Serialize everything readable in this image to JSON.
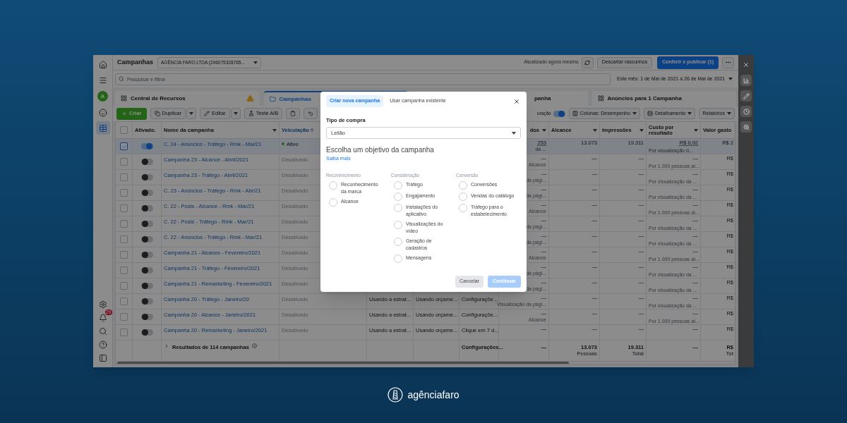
{
  "sidebar": {
    "avatar": "A",
    "items": [
      {
        "kind": "home",
        "selected": false
      },
      {
        "kind": "menu",
        "selected": false
      },
      {
        "kind": "emoji",
        "selected": false
      },
      {
        "kind": "table",
        "selected": true
      },
      {
        "kind": "settings",
        "selected": false
      },
      {
        "kind": "bell",
        "badge": "29",
        "selected": false
      },
      {
        "kind": "search",
        "selected": false
      },
      {
        "kind": "help",
        "selected": false
      },
      {
        "kind": "panel",
        "selected": false
      }
    ]
  },
  "header": {
    "title": "Campanhas",
    "account": "AGÊNCIA FARO LTDA (246075328765...",
    "status": "Atualizado agora mesmo",
    "discard": "Descartar rascunhos",
    "publish": "Conferir e publicar (1)"
  },
  "search": {
    "placeholder": "Pesquisar e filtrar",
    "date_range": "Este mês: 1 de Mai de 2021 a 26 de Mai de 2021"
  },
  "tabs": [
    {
      "label": "Central de Recursos",
      "selected": false,
      "warning": true
    },
    {
      "label": "Campanhas",
      "selected": true,
      "warning": false
    },
    {
      "label": "panha",
      "selected": false,
      "warning": false
    },
    {
      "label": "Anúncios para 1 Campanha",
      "selected": false,
      "warning": false
    }
  ],
  "toolbar": {
    "create": "Criar",
    "duplicate": "Duplicar",
    "edit": "Editar",
    "ab_test": "Teste A/B",
    "view_label": "uração",
    "view_on": true,
    "columns": "Colunas: Desempenho",
    "breakdown": "Detalhamento",
    "reports": "Relatórios"
  },
  "table": {
    "select_all_checked": false,
    "header": {
      "active": "Ativado.",
      "name": "Nome da campanha",
      "delivery": "Veiculação",
      "results": "dos",
      "reach": "Alcance",
      "impressions": "Impressões",
      "cost": "Custo por resultado",
      "spent": "Valor gasto"
    },
    "rows": [
      {
        "selected": true,
        "checked": true,
        "on": true,
        "name": "C. 24 - Anúncios - Tráfego - Rmk - Mai/21",
        "delivery": "Ativo",
        "delivery_active": true,
        "results": "253",
        "results_note": "da ...",
        "reach": "13.073",
        "impressions": "19.311",
        "cost": "R$ 0,92",
        "cost_note": "Por visualização d...",
        "spent": "R$ 2"
      },
      {
        "selected": false,
        "checked": false,
        "on": false,
        "name": "Campanha 23 - Alcance - Abril/2021",
        "delivery": "Desativado",
        "delivery_active": false,
        "results": "—",
        "results_note": "Alcance",
        "reach": "—",
        "impressions": "—",
        "cost": "—",
        "cost_note": "Por 1.000 pessoas al...",
        "spent": "R$"
      },
      {
        "selected": false,
        "checked": false,
        "on": false,
        "name": "Campanha 23 - Tráfego - Abril/2021",
        "delivery": "Desativado",
        "delivery_active": false,
        "results": "—",
        "results_note": "da pági...",
        "reach": "—",
        "impressions": "—",
        "cost": "—",
        "cost_note": "Por visualização da ...",
        "spent": "R$"
      },
      {
        "selected": false,
        "checked": false,
        "on": false,
        "name": "C. 23 - Anúncios - Tráfego - Rmk - Abr/21",
        "delivery": "Desativado",
        "delivery_active": false,
        "results": "—",
        "results_note": "da pági...",
        "reach": "—",
        "impressions": "—",
        "cost": "—",
        "cost_note": "Por visualização da ...",
        "spent": "R$"
      },
      {
        "selected": false,
        "checked": false,
        "on": false,
        "name": "C. 22 - Posts - Alcance - Rmk - Mar/21",
        "delivery": "Desativado",
        "delivery_active": false,
        "results": "—",
        "results_note": "Alcance",
        "reach": "—",
        "impressions": "—",
        "cost": "—",
        "cost_note": "Por 1.000 pessoas al...",
        "spent": "R$"
      },
      {
        "selected": false,
        "checked": false,
        "on": false,
        "name": "C. 22 - Posts - Tráfego - Rmk - Mar/21",
        "delivery": "Desativado",
        "delivery_active": false,
        "results": "—",
        "results_note": "da pági...",
        "reach": "—",
        "impressions": "—",
        "cost": "—",
        "cost_note": "Por visualização da ...",
        "spent": "R$"
      },
      {
        "selected": false,
        "checked": false,
        "on": false,
        "name": "C. 22 - Anúncios - Tráfego - Rmk - Mar/21",
        "delivery": "Desativado",
        "delivery_active": false,
        "results": "—",
        "results_note": "da pági...",
        "reach": "—",
        "impressions": "—",
        "cost": "—",
        "cost_note": "Por visualização da ...",
        "spent": "R$"
      },
      {
        "selected": false,
        "checked": false,
        "on": false,
        "name": "Campanha 21 - Alcance - Fevereiro/2021",
        "delivery": "Desativado",
        "delivery_active": false,
        "results": "—",
        "results_note": "Alcance",
        "reach": "—",
        "impressions": "—",
        "cost": "—",
        "cost_note": "Por 1.000 pessoas al...",
        "spent": "R$"
      },
      {
        "selected": false,
        "checked": false,
        "on": false,
        "name": "Campanha 21 - Tráfego - Fevereiro/2021",
        "delivery": "Desativado",
        "delivery_active": false,
        "results": "—",
        "results_note": "da pági...",
        "reach": "—",
        "impressions": "—",
        "cost": "—",
        "cost_note": "Por visualização da ...",
        "spent": "R$"
      },
      {
        "selected": false,
        "checked": false,
        "on": false,
        "name": "Campanha 21 - Remarketing - Fevereiro/2021",
        "delivery": "Desativado",
        "delivery_active": false,
        "results": "—",
        "results_note": "da pági...",
        "reach": "—",
        "impressions": "—",
        "cost": "—",
        "cost_note": "Por visualização da ...",
        "spent": "R$"
      },
      {
        "selected": false,
        "checked": false,
        "on": false,
        "name": "Campanha 20 - Tráfego - Janeiro/20",
        "delivery": "Desativado",
        "delivery_active": false,
        "bid_strategy": "Usando a estrat...",
        "budget": "Usando orçame...",
        "attribution": "Configuraçõe...",
        "results": "—",
        "results_note": "Visualização da pági...",
        "reach": "—",
        "impressions": "—",
        "cost": "—",
        "cost_note": "Por visualização da ...",
        "spent": "R$"
      },
      {
        "selected": false,
        "checked": false,
        "on": false,
        "name": "Campanha 20 - Alcance - Janeiro/2021",
        "delivery": "Desativado",
        "delivery_active": false,
        "bid_strategy": "Usando a estrat...",
        "budget": "Usando orçame...",
        "attribution": "Configuraçõe...",
        "results": "—",
        "results_note": "Alcance",
        "reach": "—",
        "impressions": "—",
        "cost": "—",
        "cost_note": "Por 1.000 pessoas al...",
        "spent": "R$"
      },
      {
        "selected": false,
        "checked": false,
        "on": false,
        "name": "Campanha 20 - Remarketing - Janeiro/2021",
        "delivery": "Desativado",
        "delivery_active": false,
        "bid_strategy": "Usando a estrat...",
        "budget": "Usando orçame...",
        "attribution": "Clique em 7 d...",
        "results": "—",
        "reach": "—",
        "impressions": "—",
        "cost": "—",
        "spent": "R$"
      }
    ],
    "footer": {
      "label": "Resultados de 114 campanhas",
      "attribution": "Configurações...",
      "results": "—",
      "reach": "13.073",
      "reach_note": "Pessoas",
      "impressions": "19.311",
      "impressions_note": "Total",
      "cost": "—",
      "spent": "R$",
      "spent_note": "Tot"
    }
  },
  "modal": {
    "tabs": [
      {
        "label": "Criar nova campanha",
        "selected": true
      },
      {
        "label": "Usar campanha existente",
        "selected": false
      }
    ],
    "buying_label": "Tipo de compra",
    "buying_type": "Leilão",
    "heading": "Escolha um objetivo da campanha",
    "link": "Saiba mais",
    "groups": [
      {
        "title": "Reconhecimento",
        "options": [
          {
            "label": "Reconhecimento da marca",
            "selected": false
          },
          {
            "label": "Alcance",
            "selected": false
          }
        ]
      },
      {
        "title": "Consideração",
        "options": [
          {
            "label": "Tráfego",
            "selected": false
          },
          {
            "label": "Engajamento",
            "selected": false
          },
          {
            "label": "Instalações do aplicativo",
            "selected": false
          },
          {
            "label": "Visualizações do vídeo",
            "selected": false
          },
          {
            "label": "Geração de cadastros",
            "selected": false
          },
          {
            "label": "Mensagens",
            "selected": false
          }
        ]
      },
      {
        "title": "Conversão",
        "options": [
          {
            "label": "Conversões",
            "selected": false
          },
          {
            "label": "Vendas do catálogo",
            "selected": false
          },
          {
            "label": "Tráfego para o estabelecimento",
            "selected": false
          }
        ]
      }
    ],
    "cancel": "Cancelar",
    "continue": "Continuar",
    "continue_disabled": true
  },
  "brand": "agência**faro**"
}
